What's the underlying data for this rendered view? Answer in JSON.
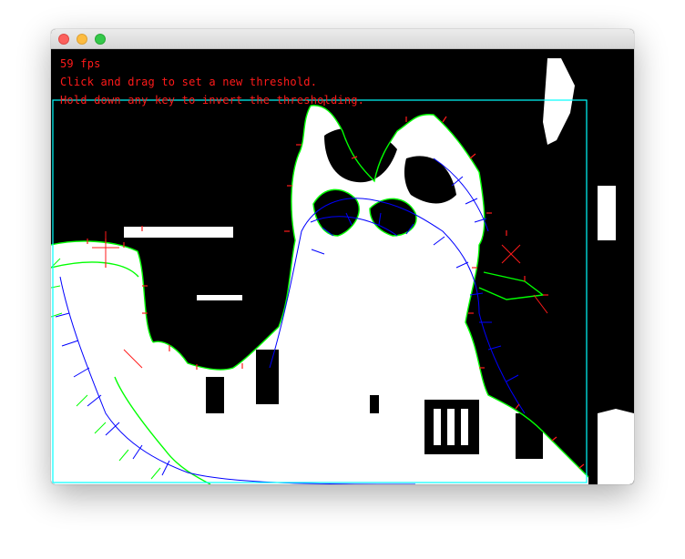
{
  "window": {
    "controls": [
      "close",
      "minimize",
      "maximize"
    ]
  },
  "overlay": {
    "fps_text": "59 fps",
    "instruction_1": "Click and drag to set a new threshold.",
    "instruction_2": "Hold down any key to invert the thresholding."
  },
  "colors": {
    "text": "#ff1a1a",
    "contour": "#00ff00",
    "normals": "#0000ff",
    "vertices": "#ff0000",
    "bounding_box": "#00ffff",
    "foreground": "#ffffff",
    "background": "#000000"
  }
}
